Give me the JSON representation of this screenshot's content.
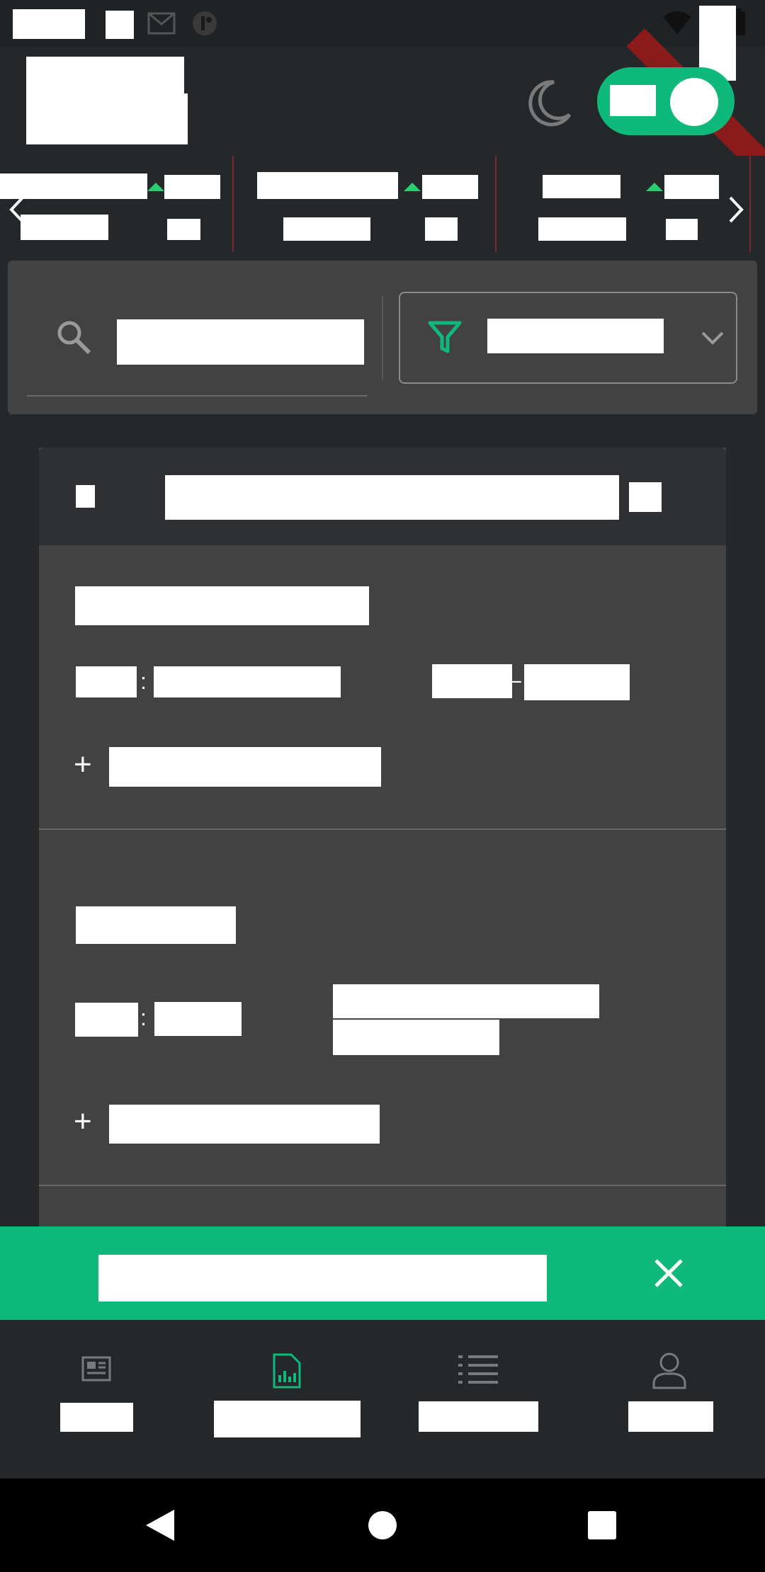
{
  "status_bar": {
    "icons": [
      "gmail-icon",
      "app-icon",
      "wifi-icon",
      "battery-icon"
    ]
  },
  "header": {
    "theme_icon": "moon-icon",
    "toggle_state": "on"
  },
  "ticker": {
    "prev_icon": "chevron-left-icon",
    "next_icon": "chevron-right-icon",
    "items": [
      {
        "trend_icon": "up-arrow-icon"
      },
      {
        "trend_icon": "up-arrow-icon"
      },
      {
        "trend_icon": "up-arrow-icon"
      }
    ]
  },
  "search": {
    "search_icon": "search-icon",
    "filter_icon": "filter-icon",
    "dropdown_icon": "chevron-down-icon"
  },
  "list": {
    "items": [
      {
        "separator": ":",
        "dash": "–",
        "add_symbol": "+"
      },
      {
        "separator": ":",
        "add_symbol": "+"
      }
    ]
  },
  "snackbar": {
    "close_icon": "close-icon"
  },
  "bottom_nav": {
    "items": [
      {
        "icon": "news-icon"
      },
      {
        "icon": "report-chart-icon",
        "active": true
      },
      {
        "icon": "list-icon"
      },
      {
        "icon": "profile-icon"
      }
    ]
  },
  "system_nav": {
    "icons": [
      "back-icon",
      "home-icon",
      "recents-icon"
    ]
  },
  "colors": {
    "accent": "#0fb97c",
    "background": "#25282b",
    "card": "#424242",
    "header_row": "#2e3033",
    "up_trend": "#2ecc71",
    "ribbon": "#8b1a1a"
  }
}
